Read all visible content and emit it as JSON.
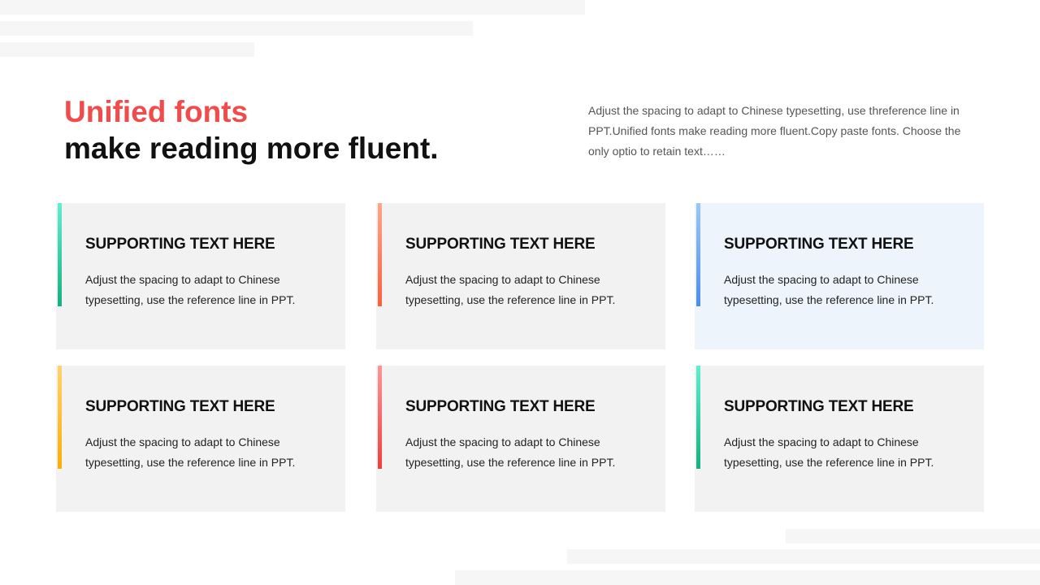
{
  "headline": {
    "accent": "Unified fonts",
    "main": "make reading more fluent."
  },
  "intro": "Adjust the spacing to adapt to Chinese typesetting, use threference line in PPT.Unified fonts make reading more fluent.Copy paste fonts. Choose the only optio to retain text……",
  "colors": {
    "accent": "#f24b4b",
    "green": "#13b080",
    "orange": "#ff5e3a",
    "blue": "#4a8df0",
    "yellow": "#ffad00",
    "red": "#f23c3c",
    "card_background": "#f2f2f2",
    "card_background_highlight": "#edf4fc"
  },
  "cards": [
    {
      "title": "SUPPORTING TEXT HERE",
      "body": "Adjust the spacing to adapt to Chinese typesetting, use the reference line in PPT.",
      "accent": "green"
    },
    {
      "title": "SUPPORTING TEXT HERE",
      "body": "Adjust the spacing to adapt to Chinese typesetting, use the reference line in PPT.",
      "accent": "orange"
    },
    {
      "title": "SUPPORTING TEXT HERE",
      "body": "Adjust the spacing to adapt to Chinese typesetting, use the reference line in PPT.",
      "accent": "blue"
    },
    {
      "title": "SUPPORTING TEXT HERE",
      "body": "Adjust the spacing to adapt to Chinese typesetting, use the reference line in PPT.",
      "accent": "yellow"
    },
    {
      "title": "SUPPORTING TEXT HERE",
      "body": "Adjust the spacing to adapt to Chinese typesetting, use the reference line in PPT.",
      "accent": "red"
    },
    {
      "title": "SUPPORTING TEXT HERE",
      "body": "Adjust the spacing to adapt to Chinese typesetting, use the reference line in PPT.",
      "accent": "green"
    }
  ]
}
